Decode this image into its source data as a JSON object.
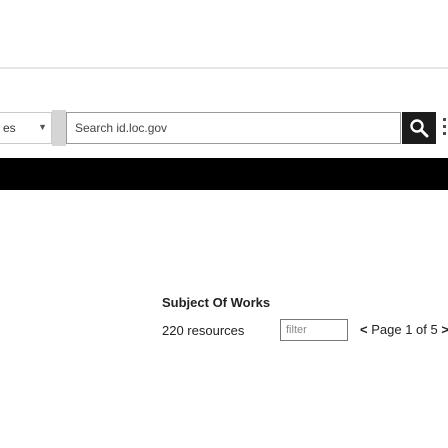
{
  "search": {
    "scope_label": "es",
    "placeholder": "Search id.loc.gov",
    "button_icon": "search-icon"
  },
  "colors": {
    "banner": "#000000",
    "button": "#1c1c1c",
    "border": "#9a9a9a"
  },
  "subject": {
    "title": "Subject Of Works",
    "resource_count": "220 resources",
    "filter_placeholder": "filter",
    "pager": {
      "prev": "<",
      "label": "Page 1 of 5",
      "next": ">"
    }
  }
}
